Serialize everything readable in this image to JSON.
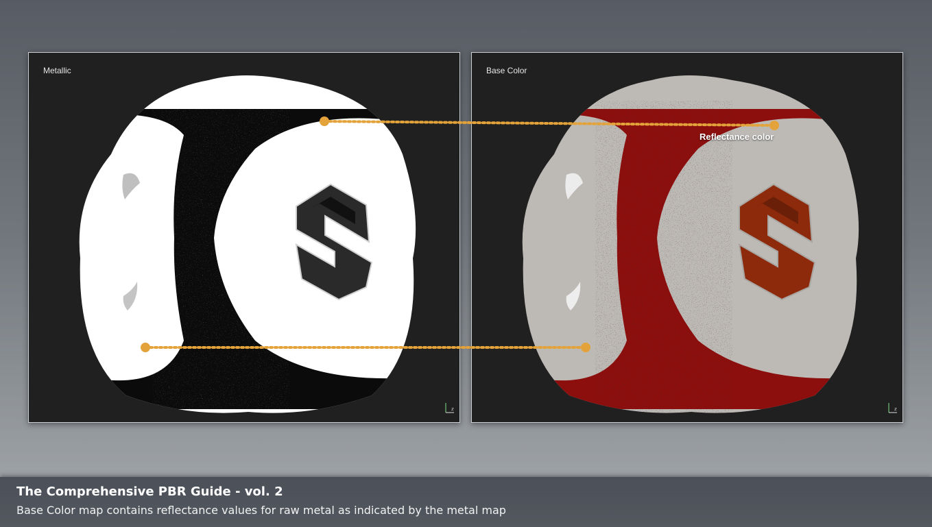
{
  "panels": {
    "left": {
      "label": "Metallic"
    },
    "right": {
      "label": "Base Color"
    }
  },
  "callout": {
    "label": "Reflectance color",
    "color": "#e3a33a"
  },
  "footer": {
    "title": "The Comprehensive PBR Guide - vol. 2",
    "subtitle": "Base Color map contains reflectance values for raw metal as indicated by the metal map"
  },
  "colors": {
    "metal_mask": "#ffffff",
    "dielectric_mask": "#000000",
    "base_metal": "#bdbab6",
    "base_dielectric": "#8c0f0e",
    "logo_fill": "#8d2a0c"
  }
}
